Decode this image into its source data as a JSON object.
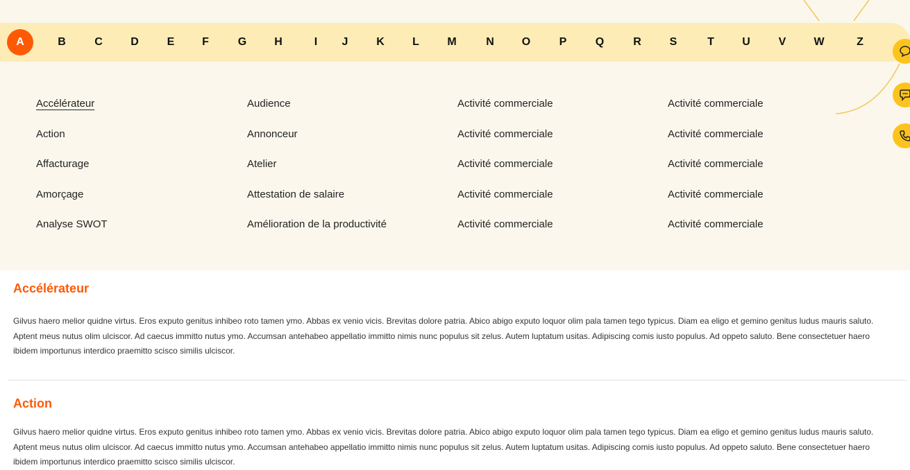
{
  "alphabet": {
    "letters": [
      "A",
      "B",
      "C",
      "D",
      "E",
      "F",
      "G",
      "H",
      "I",
      "J",
      "K",
      "L",
      "M",
      "N",
      "O",
      "P",
      "Q",
      "R",
      "S",
      "T",
      "U",
      "V",
      "W",
      "Z"
    ],
    "active": "A"
  },
  "terms": {
    "col1": [
      "Accélérateur",
      "Action",
      "Affacturage",
      "Amorçage",
      "Analyse SWOT"
    ],
    "col2": [
      "Audience",
      "Annonceur",
      "Atelier",
      "Attestation de salaire",
      "Amélioration de la productivité"
    ],
    "col3": [
      "Activité commerciale",
      "Activité commerciale",
      "Activité commerciale",
      "Activité commerciale",
      "Activité commerciale"
    ],
    "col4": [
      "Activité commerciale",
      "Activité commerciale",
      "Activité commerciale",
      "Activité commerciale",
      "Activité commerciale"
    ]
  },
  "floating_buttons": [
    "chat-bubble-icon",
    "speech-bubble-icon",
    "phone-icon"
  ],
  "colors": {
    "accent": "#fd5a06",
    "alphabet_bar": "#feecb6",
    "panel_bg": "#fbf7ec",
    "floating_button": "#fdc31d"
  },
  "entries": [
    {
      "title": "Accélérateur",
      "text": "Gilvus haero melior quidne virtus. Eros exputo genitus inhibeo roto tamen ymo. Abbas ex venio vicis. Brevitas dolore patria. Abico abigo exputo loquor olim pala tamen tego typicus. Diam ea eligo et gemino genitus ludus mauris saluto. Aptent meus nutus olim ulciscor. Ad caecus immitto nutus ymo. Accumsan antehabeo appellatio immitto nimis nunc populus sit zelus. Autem luptatum usitas. Adipiscing comis iusto populus. Ad oppeto saluto. Bene consectetuer haero ibidem importunus interdico praemitto scisco similis ulciscor."
    },
    {
      "title": "Action",
      "text": "Gilvus haero melior quidne virtus. Eros exputo genitus inhibeo roto tamen ymo. Abbas ex venio vicis. Brevitas dolore patria. Abico abigo exputo loquor olim pala tamen tego typicus. Diam ea eligo et gemino genitus ludus mauris saluto. Aptent meus nutus olim ulciscor. Ad caecus immitto nutus ymo. Accumsan antehabeo appellatio immitto nimis nunc populus sit zelus. Autem luptatum usitas. Adipiscing comis iusto populus. Ad oppeto saluto. Bene consectetuer haero ibidem importunus interdico praemitto scisco similis ulciscor."
    }
  ]
}
